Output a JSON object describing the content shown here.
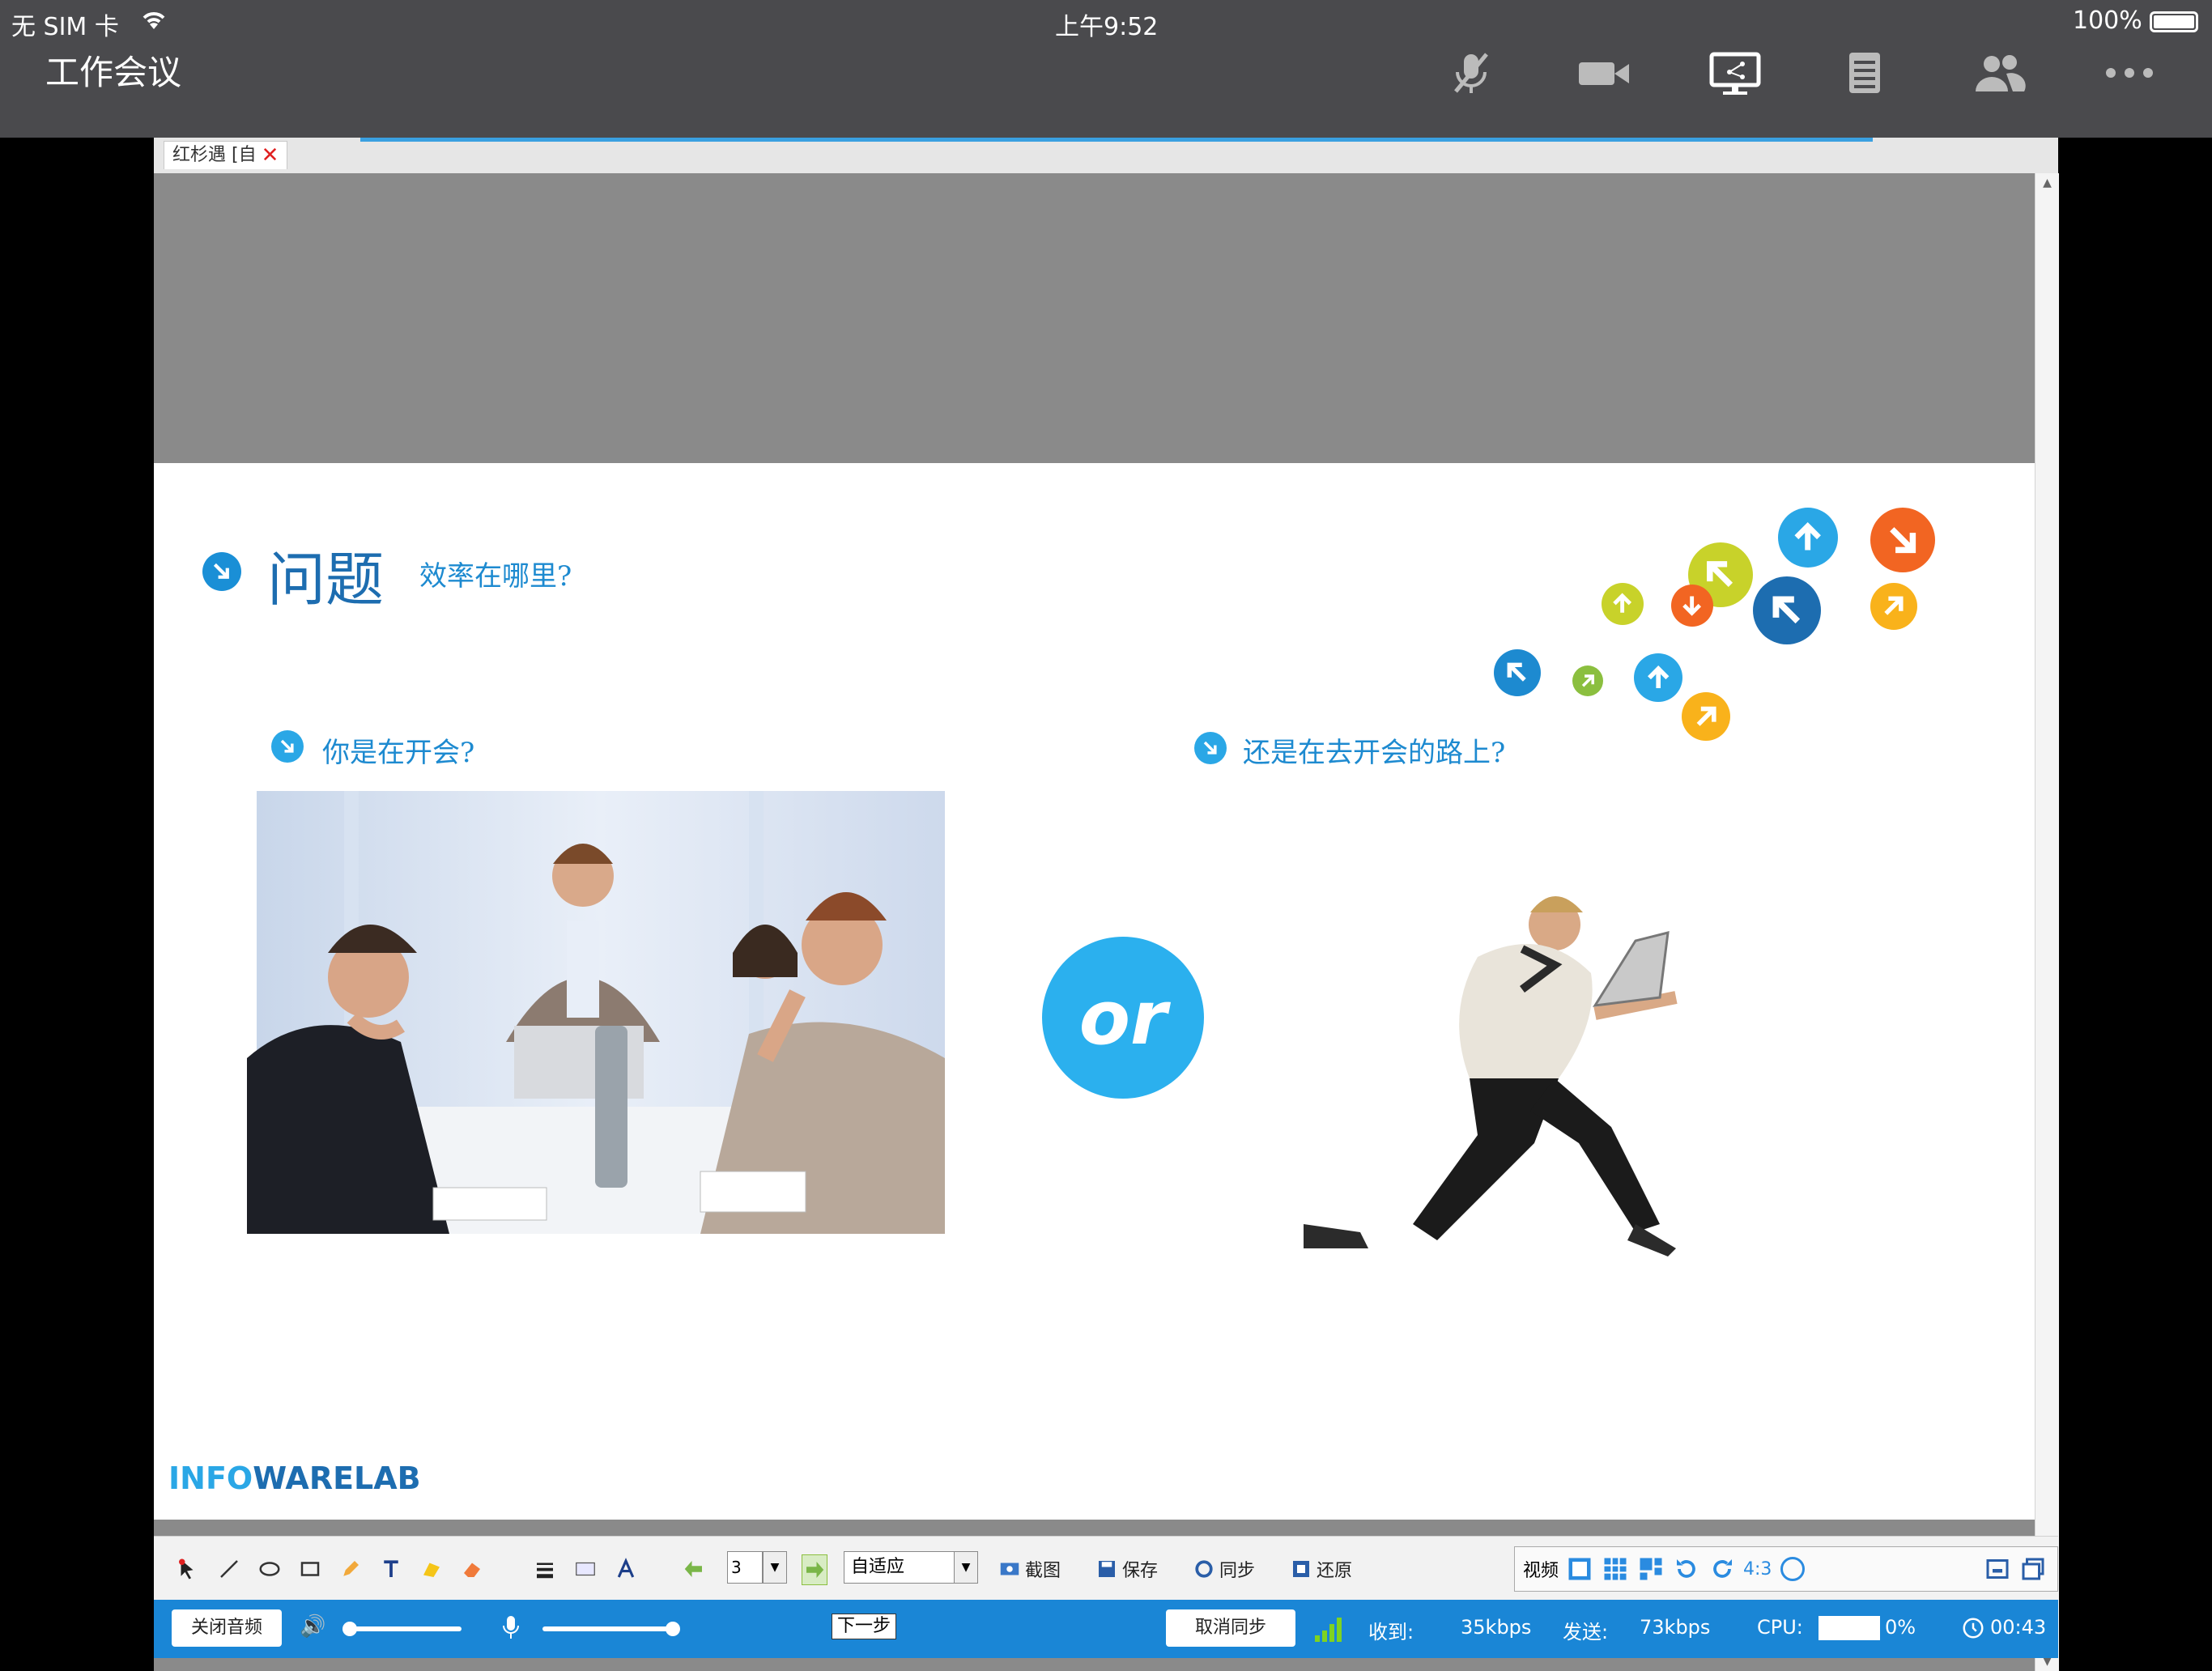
{
  "status_bar": {
    "carrier": "无 SIM 卡",
    "time": "上午9:52",
    "battery": "100%"
  },
  "app": {
    "title": "工作会议"
  },
  "top_icons": [
    "mic-muted-icon",
    "video-camera-icon",
    "screen-share-icon",
    "document-icon",
    "participants-icon",
    "more-icon"
  ],
  "document": {
    "tab_label": "红杉遇 [自"
  },
  "slide": {
    "title": "问题",
    "subtitle": "效率在哪里?",
    "left_question": "你是在开会?",
    "right_question": "还是在去开会的路上?",
    "or_label": "or",
    "logo_part1": "INFO",
    "logo_part2": "WARELAB"
  },
  "toolbar": {
    "page_number": "3",
    "zoom": "自适应",
    "screenshot_label": "截图",
    "save_label": "保存",
    "sync_label": "同步",
    "restore_label": "还原",
    "video_label": "视频",
    "aspect_label": "4:3",
    "next_tooltip": "下一步"
  },
  "bottom": {
    "close_audio": "关闭音频",
    "cancel_sync": "取消同步",
    "recv_label": "收到:",
    "recv_value": "35kbps",
    "send_label": "发送:",
    "send_value": "73kbps",
    "cpu_label": "CPU:",
    "cpu_value": "0%",
    "elapsed": "00:43"
  },
  "colors": {
    "accent_blue": "#1a86d6",
    "slide_title": "#1d6db0",
    "or_circle": "#2bb0ee"
  }
}
